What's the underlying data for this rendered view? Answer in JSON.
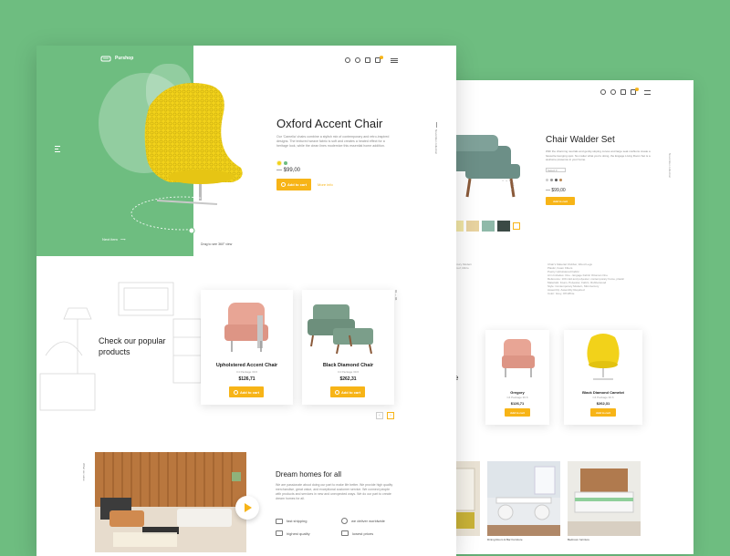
{
  "front": {
    "brand": "Purshop",
    "cart_count": "2",
    "hero": {
      "title": "Oxford Accent Chair",
      "description": "Our 'Camelia' chairs combine a stylish mix of contemporary and retro-inspired designs. The textured weave fabric is soft and creates a heated effect for a heritage look, while the clean lines modernize this essential home addition.",
      "price": "$99,00",
      "add_to_cart": "Add to cart",
      "more_info": "More info",
      "next_item": "Next item",
      "drag_hint": "Drag to see 360° view",
      "side_label": "November collection"
    },
    "popular": {
      "heading": "Check our popular products",
      "page_indicator": "01",
      "page_total": "06",
      "products": [
        {
          "name": "Upholstered Accent Chair",
          "meta": "C4 Package 30.6",
          "price": "$126,71",
          "cta": "Add to cart"
        },
        {
          "name": "Black Diamond Chair",
          "meta": "C4 Package 30.6",
          "price": "$262,31",
          "cta": "Add to cart"
        }
      ]
    },
    "dream": {
      "side_label": "What we value",
      "title": "Dream homes for all",
      "text": "We are passionate about doing our part to make life better. We provide high quality merchandise, great value, and exceptional customer service. We connect people with products and services in new and unexpected ways. We do our part to create dream homes for all.",
      "features": [
        "fast shipping",
        "we deliver worldwide",
        "highest quality",
        "lowest prices"
      ]
    }
  },
  "back": {
    "cart_count": "2",
    "hero": {
      "title": "Chair Walder Set",
      "description": "With the charming neutrals and gently-sloping curves and large seat cushions create a favourite lounging spot. No matter what you're doing, the Engage Living Room Set is a welcome presence in your home.",
      "select_label": "Select ▾",
      "price": "$99,00",
      "add_to_cart": "Add to cart",
      "side_label": "November collection"
    },
    "specs_left": [
      "Mid Century Modern",
      "Waterproof, Micro"
    ],
    "specs_right": [
      "Chair's Material: Rubber, Wood Legs",
      "Plastic, Foam Fibers",
      "Poetry Upholstered Fabric",
      "Arm Includes: One - Engage Fabric Ottoman One",
      "Reference: 100 cold and polyester, contemporary home, plastic",
      "Materials: Foam, Polyester, Fabric, Rubberwood",
      "Style: Contemporary Modern, Mid-Century",
      "Assembly: Assembly Required",
      "Color: Grey, Off-White"
    ],
    "products": [
      {
        "name": "Gregory",
        "meta": "C4 Package 30.6",
        "price": "$126,71",
        "cta": "Add to cart"
      },
      {
        "name": "Black Diamond Camelot",
        "meta": "C4 Package 30.6",
        "price": "$262,31",
        "cta": "Add to cart"
      }
    ],
    "side_label_left": "ke",
    "rooms": [
      "Dining Room & Bar Furniture",
      "Bedroom furniture"
    ]
  },
  "colors": {
    "accent": "#f7b417",
    "brand_green": "#6ebd80",
    "yellow_chair": "#f2d21a"
  }
}
